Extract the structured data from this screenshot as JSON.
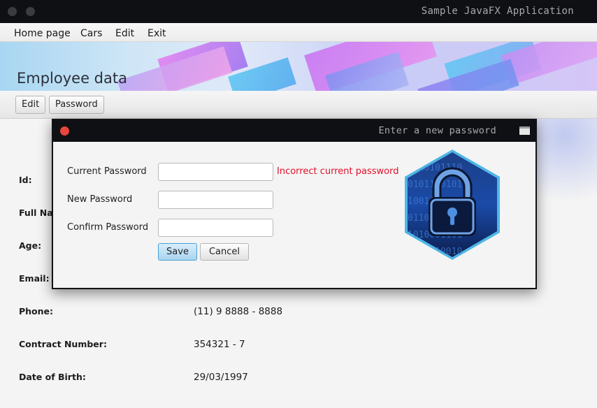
{
  "window": {
    "title": "Sample JavaFX Application"
  },
  "menu": {
    "items": [
      "Home page",
      "Cars",
      "Edit",
      "Exit"
    ]
  },
  "banner": {
    "title": "Employee data"
  },
  "toolbar": {
    "edit_label": "Edit",
    "password_label": "Password"
  },
  "details": {
    "fields": [
      {
        "label": "Id:",
        "value": ""
      },
      {
        "label": "Full Na",
        "value": ""
      },
      {
        "label": "Age:",
        "value": ""
      },
      {
        "label": "Email:",
        "value": ""
      },
      {
        "label": "Phone:",
        "value": "(11) 9 8888 - 8888"
      },
      {
        "label": "Contract Number:",
        "value": "354321 - 7"
      },
      {
        "label": "Date of Birth:",
        "value": "29/03/1997"
      }
    ]
  },
  "dialog": {
    "title": "Enter a new password",
    "current_password_label": "Current Password",
    "new_password_label": "New Password",
    "confirm_password_label": "Confirm Password",
    "current_password_value": "",
    "new_password_value": "",
    "confirm_password_value": "",
    "error_text": "Incorrect current password",
    "save_label": "Save",
    "cancel_label": "Cancel",
    "icon": "padlock-icon"
  },
  "colors": {
    "error": "#e0102b",
    "accent": "#4a9fd6",
    "titlebar": "#0f1014"
  }
}
